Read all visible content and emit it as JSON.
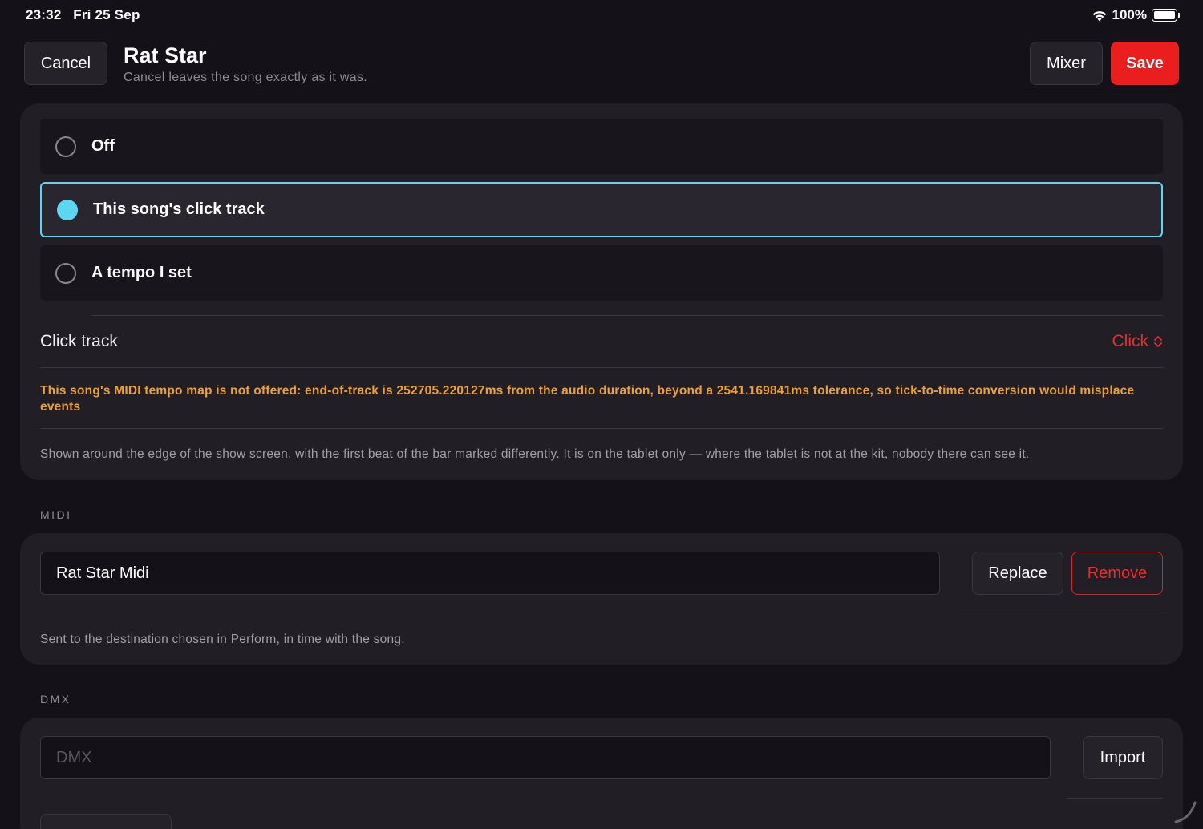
{
  "status_bar": {
    "time": "23:32",
    "date": "Fri 25 Sep",
    "battery_percent": "100%",
    "wifi_icon": "wifi-icon",
    "battery_icon": "battery-icon"
  },
  "header": {
    "cancel_label": "Cancel",
    "title": "Rat Star",
    "subtitle": "Cancel leaves the song exactly as it was.",
    "mixer_label": "Mixer",
    "save_label": "Save"
  },
  "click_section": {
    "options": [
      {
        "label": "Off",
        "selected": false
      },
      {
        "label": "This song's click track",
        "selected": true
      },
      {
        "label": "A tempo I set",
        "selected": false
      }
    ],
    "click_track_label": "Click track",
    "click_track_value": "Click",
    "warning": "This song's MIDI tempo map is not offered: end-of-track is 252705.220127ms from the audio duration, beyond a 2541.169841ms tolerance, so tick-to-time conversion would misplace events",
    "help": "Shown around the edge of the show screen, with the first beat of the bar marked differently. It is on the tablet only — where the tablet is not at the kit, nobody there can see it."
  },
  "midi_section": {
    "label": "MIDI",
    "file_name": "Rat Star Midi",
    "replace_label": "Replace",
    "remove_label": "Remove",
    "help": "Sent to the destination chosen in Perform, in time with the song."
  },
  "dmx_section": {
    "label": "DMX",
    "placeholder": "DMX",
    "import_label": "Import"
  },
  "colors": {
    "accent_cyan": "#5dd6f2",
    "danger_red": "#ea1e1e",
    "warning_orange": "#f0a12b",
    "background": "#141218",
    "card": "#211e25"
  }
}
